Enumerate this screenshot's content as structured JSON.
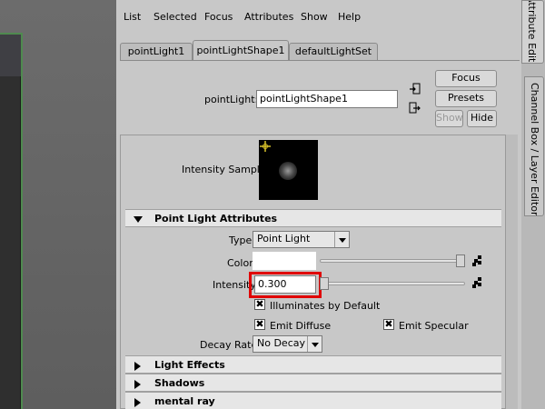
{
  "menubar": {
    "items": [
      "List",
      "Selected",
      "Focus",
      "Attributes",
      "Show",
      "Help"
    ]
  },
  "tabs": [
    {
      "label": "pointLight1",
      "active": false
    },
    {
      "label": "pointLightShape1",
      "active": true
    },
    {
      "label": "defaultLightSet",
      "active": false
    }
  ],
  "node": {
    "label": "pointLight:",
    "value": "pointLightShape1"
  },
  "buttons": {
    "focus": "Focus",
    "presets": "Presets",
    "show": "Show",
    "hide": "Hide"
  },
  "intensity_sample": {
    "label": "Intensity Sample"
  },
  "point_light_attributes": {
    "title": "Point Light Attributes",
    "type_label": "Type",
    "type_value": "Point Light",
    "color_label": "Color",
    "color_value": "#ffffff",
    "intensity_label": "Intensity",
    "intensity_value": "0.300",
    "illuminates_label": "Illuminates by Default",
    "emit_diffuse_label": "Emit Diffuse",
    "emit_specular_label": "Emit Specular",
    "decay_label": "Decay Rate",
    "decay_value": "No Decay",
    "illuminates_checked": true,
    "emit_diffuse_checked": true,
    "emit_specular_checked": true,
    "color_slider_level": 1.0,
    "intensity_slider_level": 0.0
  },
  "collapsed_sections": [
    "Light Effects",
    "Shadows",
    "mental ray"
  ],
  "side_tabs": {
    "attribute_editor": "Attribute Editor",
    "channel_box": "Channel Box / Layer Editor"
  },
  "colors": {
    "highlight": "#e00000",
    "panel_bg": "#c8c8c8"
  }
}
